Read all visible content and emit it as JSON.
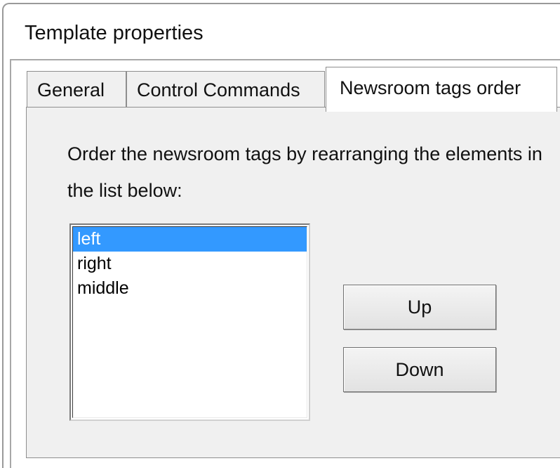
{
  "window": {
    "title": "Template properties"
  },
  "tabs": [
    {
      "label": "General",
      "selected": false
    },
    {
      "label": "Control Commands",
      "selected": false
    },
    {
      "label": "Newsroom tags order",
      "selected": true
    }
  ],
  "panel": {
    "instruction": "Order the newsroom tags by rearranging the elements in the list below:",
    "list": {
      "items": [
        "left",
        "right",
        "middle"
      ],
      "selected_index": 0
    },
    "buttons": {
      "up_label": "Up",
      "down_label": "Down"
    }
  },
  "colors": {
    "selection_background": "#3399ff",
    "panel_background": "#f0f0f0"
  }
}
